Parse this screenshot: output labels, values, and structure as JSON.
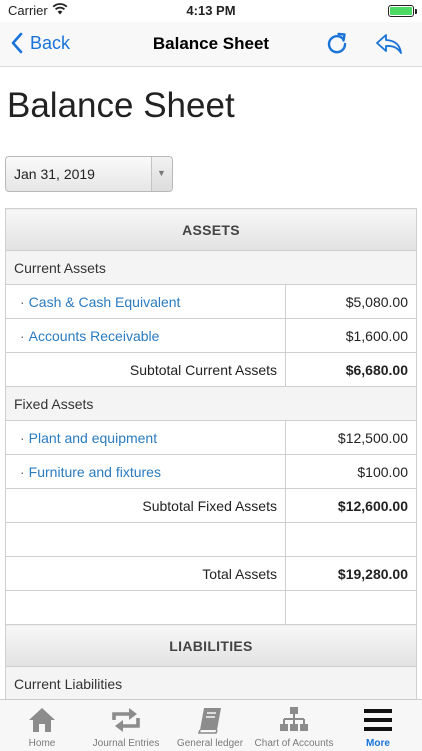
{
  "status_bar": {
    "carrier": "Carrier",
    "time": "4:13 PM"
  },
  "nav": {
    "back_label": "Back",
    "title": "Balance Sheet"
  },
  "page": {
    "heading": "Balance Sheet"
  },
  "date_select": {
    "selected": "Jan 31, 2019"
  },
  "balance_sheet": {
    "assets_header": "ASSETS",
    "current_assets": {
      "label": "Current Assets",
      "items": [
        {
          "name": "Cash & Cash Equivalent",
          "amount": "$5,080.00"
        },
        {
          "name": "Accounts Receivable",
          "amount": "$1,600.00"
        }
      ],
      "subtotal_label": "Subtotal Current Assets",
      "subtotal": "$6,680.00"
    },
    "fixed_assets": {
      "label": "Fixed Assets",
      "items": [
        {
          "name": "Plant and equipment",
          "amount": "$12,500.00"
        },
        {
          "name": "Furniture and fixtures",
          "amount": "$100.00"
        }
      ],
      "subtotal_label": "Subtotal Fixed Assets",
      "subtotal": "$12,600.00"
    },
    "total_label": "Total Assets",
    "total": "$19,280.00",
    "liabilities_header": "LIABILITIES",
    "current_liabilities_label": "Current Liabilities"
  },
  "tab_bar": {
    "tabs": [
      {
        "label": "Home",
        "icon": "home-icon"
      },
      {
        "label": "Journal Entries",
        "icon": "repeat-icon"
      },
      {
        "label": "General ledger",
        "icon": "book-icon"
      },
      {
        "label": "Chart of Accounts",
        "icon": "hierarchy-icon"
      },
      {
        "label": "More",
        "icon": "menu-icon"
      }
    ],
    "active_index": 4
  },
  "colors": {
    "accent": "#1a73d9",
    "link": "#2a7bc0",
    "battery": "#4cd964"
  }
}
